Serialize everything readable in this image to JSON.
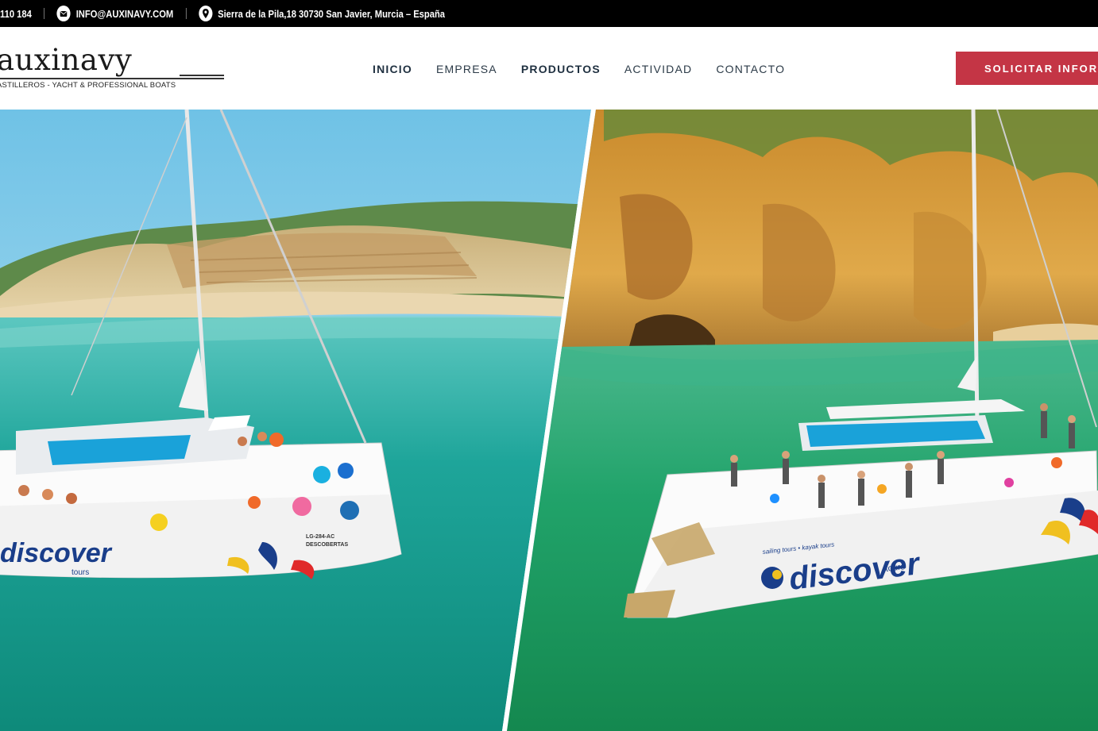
{
  "topbar": {
    "phone": "110 184",
    "email": "INFO@AUXINAVY.COM",
    "address": "Sierra de la Pila,18 30730 San Javier, Murcia – España",
    "icons": [
      "mail-icon",
      "location-pin-icon"
    ]
  },
  "logo": {
    "name": "auxinavy",
    "tagline": "ASTILLEROS - YACHT & PROFESSIONAL BOATS"
  },
  "nav": {
    "items": [
      {
        "label": "INICIO",
        "active": true
      },
      {
        "label": "EMPRESA",
        "active": false
      },
      {
        "label": "PRODUCTOS",
        "active": true
      },
      {
        "label": "ACTIVIDAD",
        "active": false
      },
      {
        "label": "CONTACTO",
        "active": false
      }
    ]
  },
  "cta": {
    "label": "SOLICITAR INFORMACIÓN"
  },
  "hero": {
    "left_hull_text": "discover",
    "left_hull_sub": "tours",
    "left_reg": "LG-284-AC",
    "left_reg_name": "DESCOBERTAS",
    "right_hull_text": "discover",
    "right_hull_sub": "tours",
    "right_hull_tag": "sailing tours • kayak tours"
  },
  "colors": {
    "topbar_bg": "#000000",
    "nav_text": "#2b3a47",
    "cta_bg": "#c43545",
    "sea_left": "#1a9a8c",
    "sea_right": "#1fa86a",
    "cliff": "#d59a3a"
  }
}
